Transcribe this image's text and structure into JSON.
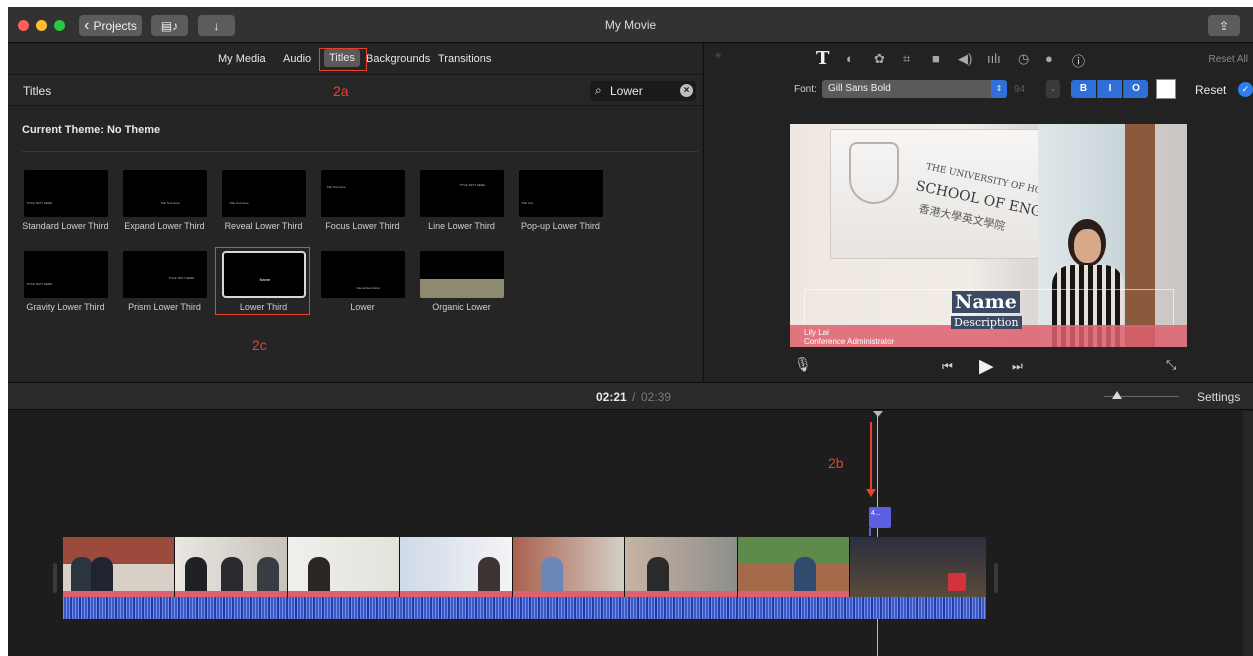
{
  "window": {
    "title": "My Movie"
  },
  "toolbar": {
    "projects_label": "Projects",
    "back_glyph": "‹",
    "media_glyph": "▤♪",
    "import_glyph": "↓",
    "share_glyph": "⇪"
  },
  "media_tabs": [
    "My Media",
    "Audio",
    "Titles",
    "Backgrounds",
    "Transitions"
  ],
  "browser": {
    "section_title": "Titles",
    "search_value": "Lower",
    "current_theme": "Current Theme: No Theme",
    "titles": [
      {
        "label": "Standard Lower Third",
        "thumb_text": "TITLE TEXT HERE"
      },
      {
        "label": "Expand Lower Third",
        "thumb_text": "Title Text Here"
      },
      {
        "label": "Reveal Lower Third",
        "thumb_text": "Title Text Here"
      },
      {
        "label": "Focus Lower Third",
        "thumb_text": "Title Text Here"
      },
      {
        "label": "Line Lower Third",
        "thumb_text": "TITLE TEXT HERE"
      },
      {
        "label": "Pop-up Lower Third",
        "thumb_text": "Title Text"
      },
      {
        "label": "Gravity Lower Third",
        "thumb_text": "TITLE TEXT HERE"
      },
      {
        "label": "Prism Lower Third",
        "thumb_text": "TITLE TEXT HERE"
      },
      {
        "label": "Lower Third",
        "thumb_text": "Name"
      },
      {
        "label": "Lower",
        "thumb_text": "Name/Description"
      },
      {
        "label": "Organic Lower",
        "thumb_text": ""
      }
    ],
    "selected_title": "Lower Third"
  },
  "annotations": {
    "a": "2a",
    "b": "2b",
    "c": "2c"
  },
  "inspector": {
    "reset_all": "Reset All",
    "font_label": "Font:",
    "font_value": "Gill Sans Bold",
    "font_size": "94",
    "bold": "B",
    "italic": "I",
    "outline": "O",
    "reset": "Reset",
    "text_color": "#ffffff"
  },
  "preview": {
    "sign_line1": "THE UNIVERSITY OF HONG KONG",
    "sign_line2": "SCHOOL OF ENGLISH",
    "sign_line3": "香港大學英文學院",
    "title_name": "Name",
    "title_description": "Description",
    "lower_name": "Lily Lai",
    "lower_role": "Conference Administrator"
  },
  "timeline": {
    "current_time": "02:21",
    "separator": "/",
    "total_time": "02:39",
    "settings_label": "Settings",
    "title_clip_label": "4..."
  },
  "colors": {
    "accent": "#2f6fd8",
    "annotation": "#e8412c",
    "title_clip": "#5b5fe0",
    "audio": "#3b58c9"
  }
}
